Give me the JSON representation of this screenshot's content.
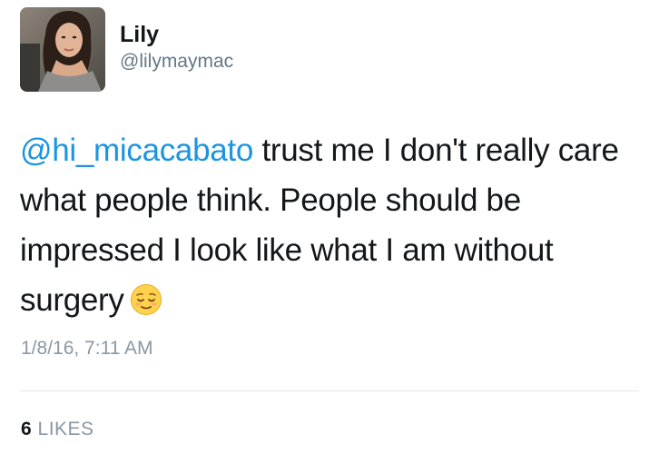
{
  "user": {
    "display_name": "Lily",
    "handle": "@lilymaymac",
    "avatar_icon": "profile-photo"
  },
  "tweet": {
    "mention": "@hi_micacabato",
    "text": " trust me I don't really care what people think. People should be impressed I look like what I am without surgery",
    "emoji": "relieved-face-emoji",
    "timestamp": "1/8/16, 7:11 AM",
    "likes_count": "6",
    "likes_label": "LIKES"
  },
  "colors": {
    "link": "#1b95e0",
    "secondary_text": "#8a97a3",
    "divider": "#e1e8ed"
  }
}
